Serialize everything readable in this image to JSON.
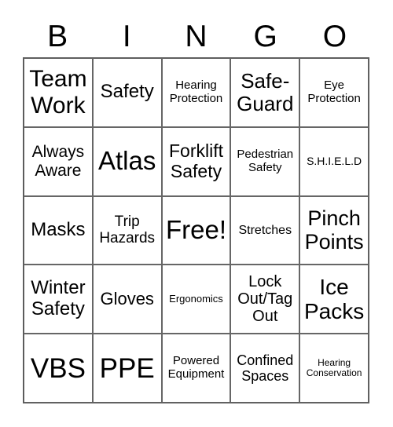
{
  "header": [
    "B",
    "I",
    "N",
    "G",
    "O"
  ],
  "cells": [
    "Team Work",
    "Safety",
    "Hearing Protection",
    "Safe-Guard",
    "Eye Protection",
    "Always Aware",
    "Atlas",
    "Forklift Safety",
    "Pedestrian Safety",
    "S.H.I.E.L.D",
    "Masks",
    "Trip Hazards",
    "Free!",
    "Stretches",
    "Pinch Points",
    "Winter Safety",
    "Gloves",
    "Ergonomics",
    "Lock Out/Tag Out",
    "Ice Packs",
    "VBS",
    "PPE",
    "Powered Equipment",
    "Confined Spaces",
    "Hearing Conservation"
  ]
}
